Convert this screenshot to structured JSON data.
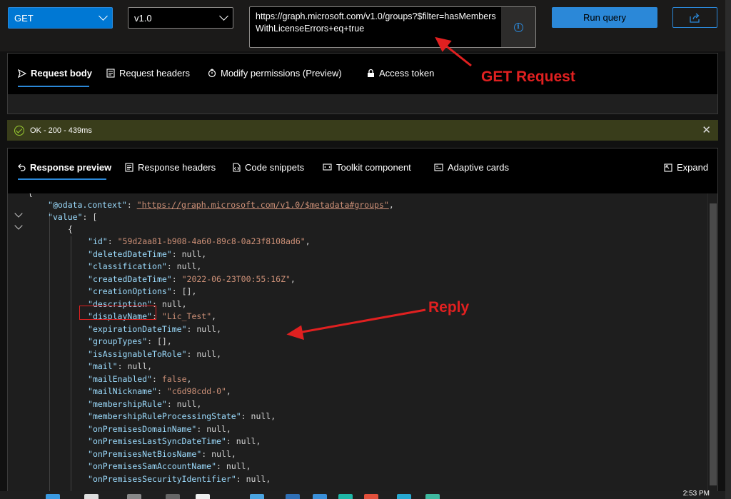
{
  "toolbar": {
    "method": "GET",
    "version": "v1.0",
    "url": "https://graph.microsoft.com/v1.0/groups?$filter=hasMembersWithLicenseErrors+eq+true",
    "run_label": "Run query"
  },
  "request_tabs": [
    {
      "label": "Request body",
      "icon": "send-icon",
      "active": true
    },
    {
      "label": "Request headers",
      "icon": "headers-icon",
      "active": false
    },
    {
      "label": "Modify permissions (Preview)",
      "icon": "shield-icon",
      "active": false
    },
    {
      "label": "Access token",
      "icon": "lock-icon",
      "active": false
    }
  ],
  "status": {
    "text": "OK - 200 - 439ms",
    "color": "#393d1b"
  },
  "response_tabs": [
    {
      "label": "Response preview",
      "icon": "undo-icon",
      "active": true
    },
    {
      "label": "Response headers",
      "icon": "headers-icon",
      "active": false
    },
    {
      "label": "Code snippets",
      "icon": "code-icon",
      "active": false
    },
    {
      "label": "Toolkit component",
      "icon": "toolkit-icon",
      "active": false
    },
    {
      "label": "Adaptive cards",
      "icon": "card-icon",
      "active": false
    }
  ],
  "expand_label": "Expand",
  "code_lines": [
    {
      "key": "@odata.context",
      "val": "https://graph.microsoft.com/v1.0/$metadata#groups",
      "kind": "link"
    },
    {
      "key": "value",
      "val": "[",
      "kind": "punct"
    },
    {
      "key": "",
      "val": "{",
      "kind": "punct"
    },
    {
      "key": "id",
      "val": "\"59d2aa81-b908-4a60-89c8-0a23f8108ad6\"",
      "kind": "str"
    },
    {
      "key": "deletedDateTime",
      "val": "null",
      "kind": "null"
    },
    {
      "key": "classification",
      "val": "null",
      "kind": "null"
    },
    {
      "key": "createdDateTime",
      "val": "\"2022-06-23T00:55:16Z\"",
      "kind": "str"
    },
    {
      "key": "creationOptions",
      "val": "[]",
      "kind": "null"
    },
    {
      "key": "description",
      "val": "null",
      "kind": "null"
    },
    {
      "key": "displayName",
      "val": "\"Lic_Test\"",
      "kind": "str"
    },
    {
      "key": "expirationDateTime",
      "val": "null",
      "kind": "null"
    },
    {
      "key": "groupTypes",
      "val": "[]",
      "kind": "null"
    },
    {
      "key": "isAssignableToRole",
      "val": "null",
      "kind": "null"
    },
    {
      "key": "mail",
      "val": "null",
      "kind": "null"
    },
    {
      "key": "mailEnabled",
      "val": "false",
      "kind": "str"
    },
    {
      "key": "mailNickname",
      "val": "\"c6d98cdd-0\"",
      "kind": "str"
    },
    {
      "key": "membershipRule",
      "val": "null",
      "kind": "null"
    },
    {
      "key": "membershipRuleProcessingState",
      "val": "null",
      "kind": "null"
    },
    {
      "key": "onPremisesDomainName",
      "val": "null",
      "kind": "null"
    },
    {
      "key": "onPremisesLastSyncDateTime",
      "val": "null",
      "kind": "null"
    },
    {
      "key": "onPremisesNetBiosName",
      "val": "null",
      "kind": "null"
    },
    {
      "key": "onPremisesSamAccountName",
      "val": "null",
      "kind": "null"
    },
    {
      "key": "onPremisesSecurityIdentifier",
      "val": "null",
      "kind": "null"
    }
  ],
  "annotations": {
    "get_request": "GET Request",
    "reply": "Reply",
    "color": "#e02020"
  },
  "taskbar": {
    "clock": "2:53 PM"
  }
}
